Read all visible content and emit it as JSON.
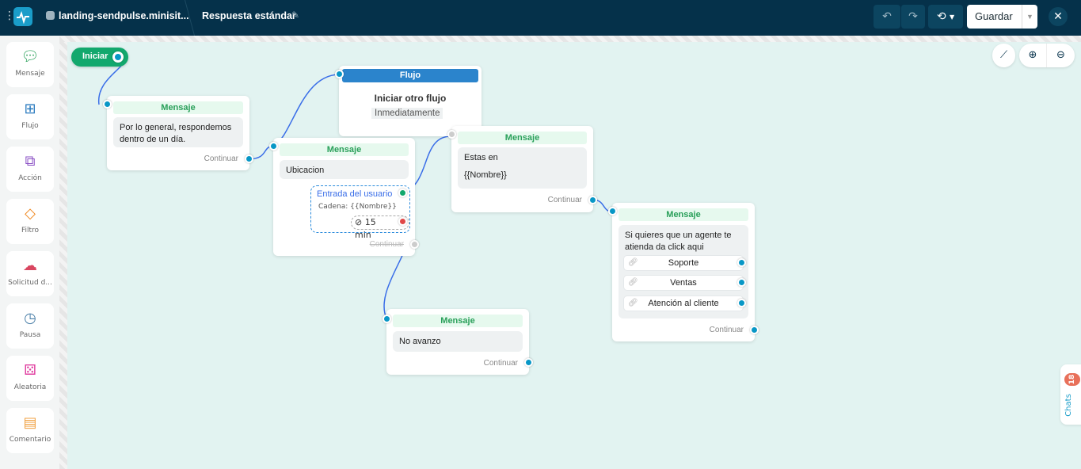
{
  "header": {
    "project": "landing-sendpulse.minisit...",
    "flow_name": "Respuesta estándar",
    "save_label": "Guardar"
  },
  "sidebar": {
    "items": [
      {
        "label": "Mensaje",
        "icon": "chat-bubble-icon",
        "color": "#2aa05a"
      },
      {
        "label": "Flujo",
        "icon": "flow-icon",
        "color": "#2b7bbf"
      },
      {
        "label": "Acción",
        "icon": "action-icon",
        "color": "#8a4fc4"
      },
      {
        "label": "Filtro",
        "icon": "filter-icon",
        "color": "#f08a24"
      },
      {
        "label": "Solicitud d...",
        "icon": "cloud-request-icon",
        "color": "#d94660"
      },
      {
        "label": "Pausa",
        "icon": "timer-icon",
        "color": "#4a7fa8"
      },
      {
        "label": "Aleatoria",
        "icon": "dice-icon",
        "color": "#e040a0"
      },
      {
        "label": "Comentario",
        "icon": "note-icon",
        "color": "#f0a040"
      }
    ]
  },
  "canvas": {
    "start_label": "Iniciar",
    "continue_label": "Continuar",
    "msg1": {
      "title": "Mensaje",
      "text": "Por lo general, respondemos dentro de un día."
    },
    "flow": {
      "title": "Flujo",
      "action": "Iniciar otro flujo",
      "timing": "Inmediatamente"
    },
    "msg2": {
      "title": "Mensaje",
      "text": "Ubicacion",
      "input_label": "Entrada del usuario",
      "input_type": "Cadena: {{Nombre}}",
      "timeout": "15 min"
    },
    "msg3": {
      "title": "Mensaje",
      "line1": "Estas en",
      "line2": "{{Nombre}}"
    },
    "msg4": {
      "title": "Mensaje",
      "text": "Si quieres que un agente te atienda da click aqui",
      "buttons": [
        "Soporte",
        "Ventas",
        "Atención al cliente"
      ]
    },
    "msg5": {
      "title": "Mensaje",
      "text": "No avanzo"
    }
  },
  "chats": {
    "label": "Chats",
    "count": "18"
  }
}
